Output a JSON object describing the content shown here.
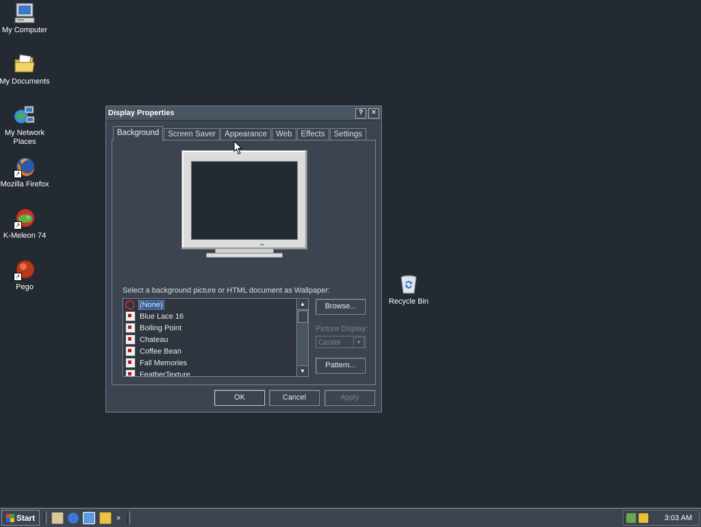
{
  "desktop": {
    "icons": [
      {
        "label": "My Computer",
        "icon": "my-computer-icon"
      },
      {
        "label": "My Documents",
        "icon": "my-documents-icon"
      },
      {
        "label": "My Network Places",
        "icon": "network-places-icon"
      },
      {
        "label": "Mozilla Firefox",
        "icon": "firefox-icon"
      },
      {
        "label": "K-Meleon 74",
        "icon": "k-meleon-icon"
      },
      {
        "label": "Pego",
        "icon": "pego-icon"
      },
      {
        "label": "Recycle Bin",
        "icon": "recycle-bin-icon"
      }
    ]
  },
  "dialog": {
    "title": "Display Properties",
    "help_button": "?",
    "close_button": "✕",
    "tabs": [
      {
        "label": "Background",
        "active": true
      },
      {
        "label": "Screen Saver",
        "active": false
      },
      {
        "label": "Appearance",
        "active": false
      },
      {
        "label": "Web",
        "active": false
      },
      {
        "label": "Effects",
        "active": false
      },
      {
        "label": "Settings",
        "active": false
      }
    ],
    "wallpaper_label": "Select a background picture or HTML document as Wallpaper:",
    "wallpapers": [
      {
        "label": "(None)",
        "selected": true
      },
      {
        "label": "Blue Lace 16",
        "selected": false
      },
      {
        "label": "Boiling Point",
        "selected": false
      },
      {
        "label": "Chateau",
        "selected": false
      },
      {
        "label": "Coffee Bean",
        "selected": false
      },
      {
        "label": "Fall Memories",
        "selected": false
      },
      {
        "label": "FeatherTexture",
        "selected": false
      }
    ],
    "browse_label": "Browse...",
    "picture_display_label": "Picture Display:",
    "picture_display_value": "Center",
    "pattern_label": "Pattern...",
    "ok_label": "OK",
    "cancel_label": "Cancel",
    "apply_label": "Apply"
  },
  "taskbar": {
    "start_label": "Start",
    "quick_launch_more": "»",
    "clock": "3:03 AM"
  },
  "colors": {
    "desktop": "#232a31",
    "dialog_face": "#3b4450",
    "selection": "#2e5f9e"
  }
}
